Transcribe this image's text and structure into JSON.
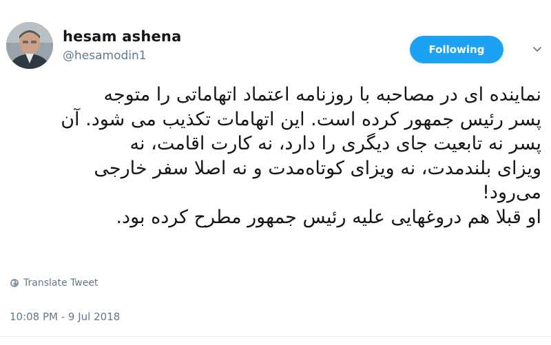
{
  "user": {
    "display_name": "hesam ashena",
    "handle": "@hesamodin1"
  },
  "follow_button": {
    "label": "Following"
  },
  "tweet": {
    "lines": [
      "نماینده ای در مصاحبه با روزنامه اعتماد اتهاماتی را متوجه",
      "پسر رئیس جمهور کرده است. این اتهامات تکذیب می شود. آن",
      "پسر نه تابعیت جای دیگری را دارد، نه کارت اقامت، نه",
      "ویزای بلندمدت، نه ویزای کوتاه‌مدت و نه اصلا سفر خارجی",
      "می‌رود!",
      "او قبلا هم دروغهایی علیه رئیس جمهور مطرح کرده بود."
    ]
  },
  "translate": {
    "label": "Translate Tweet",
    "icon": "globe-icon"
  },
  "timestamp": "10:08 PM - 9 Jul 2018",
  "colors": {
    "accent": "#1da1f2",
    "secondary_text": "#657786",
    "primary_text": "#14171a"
  }
}
